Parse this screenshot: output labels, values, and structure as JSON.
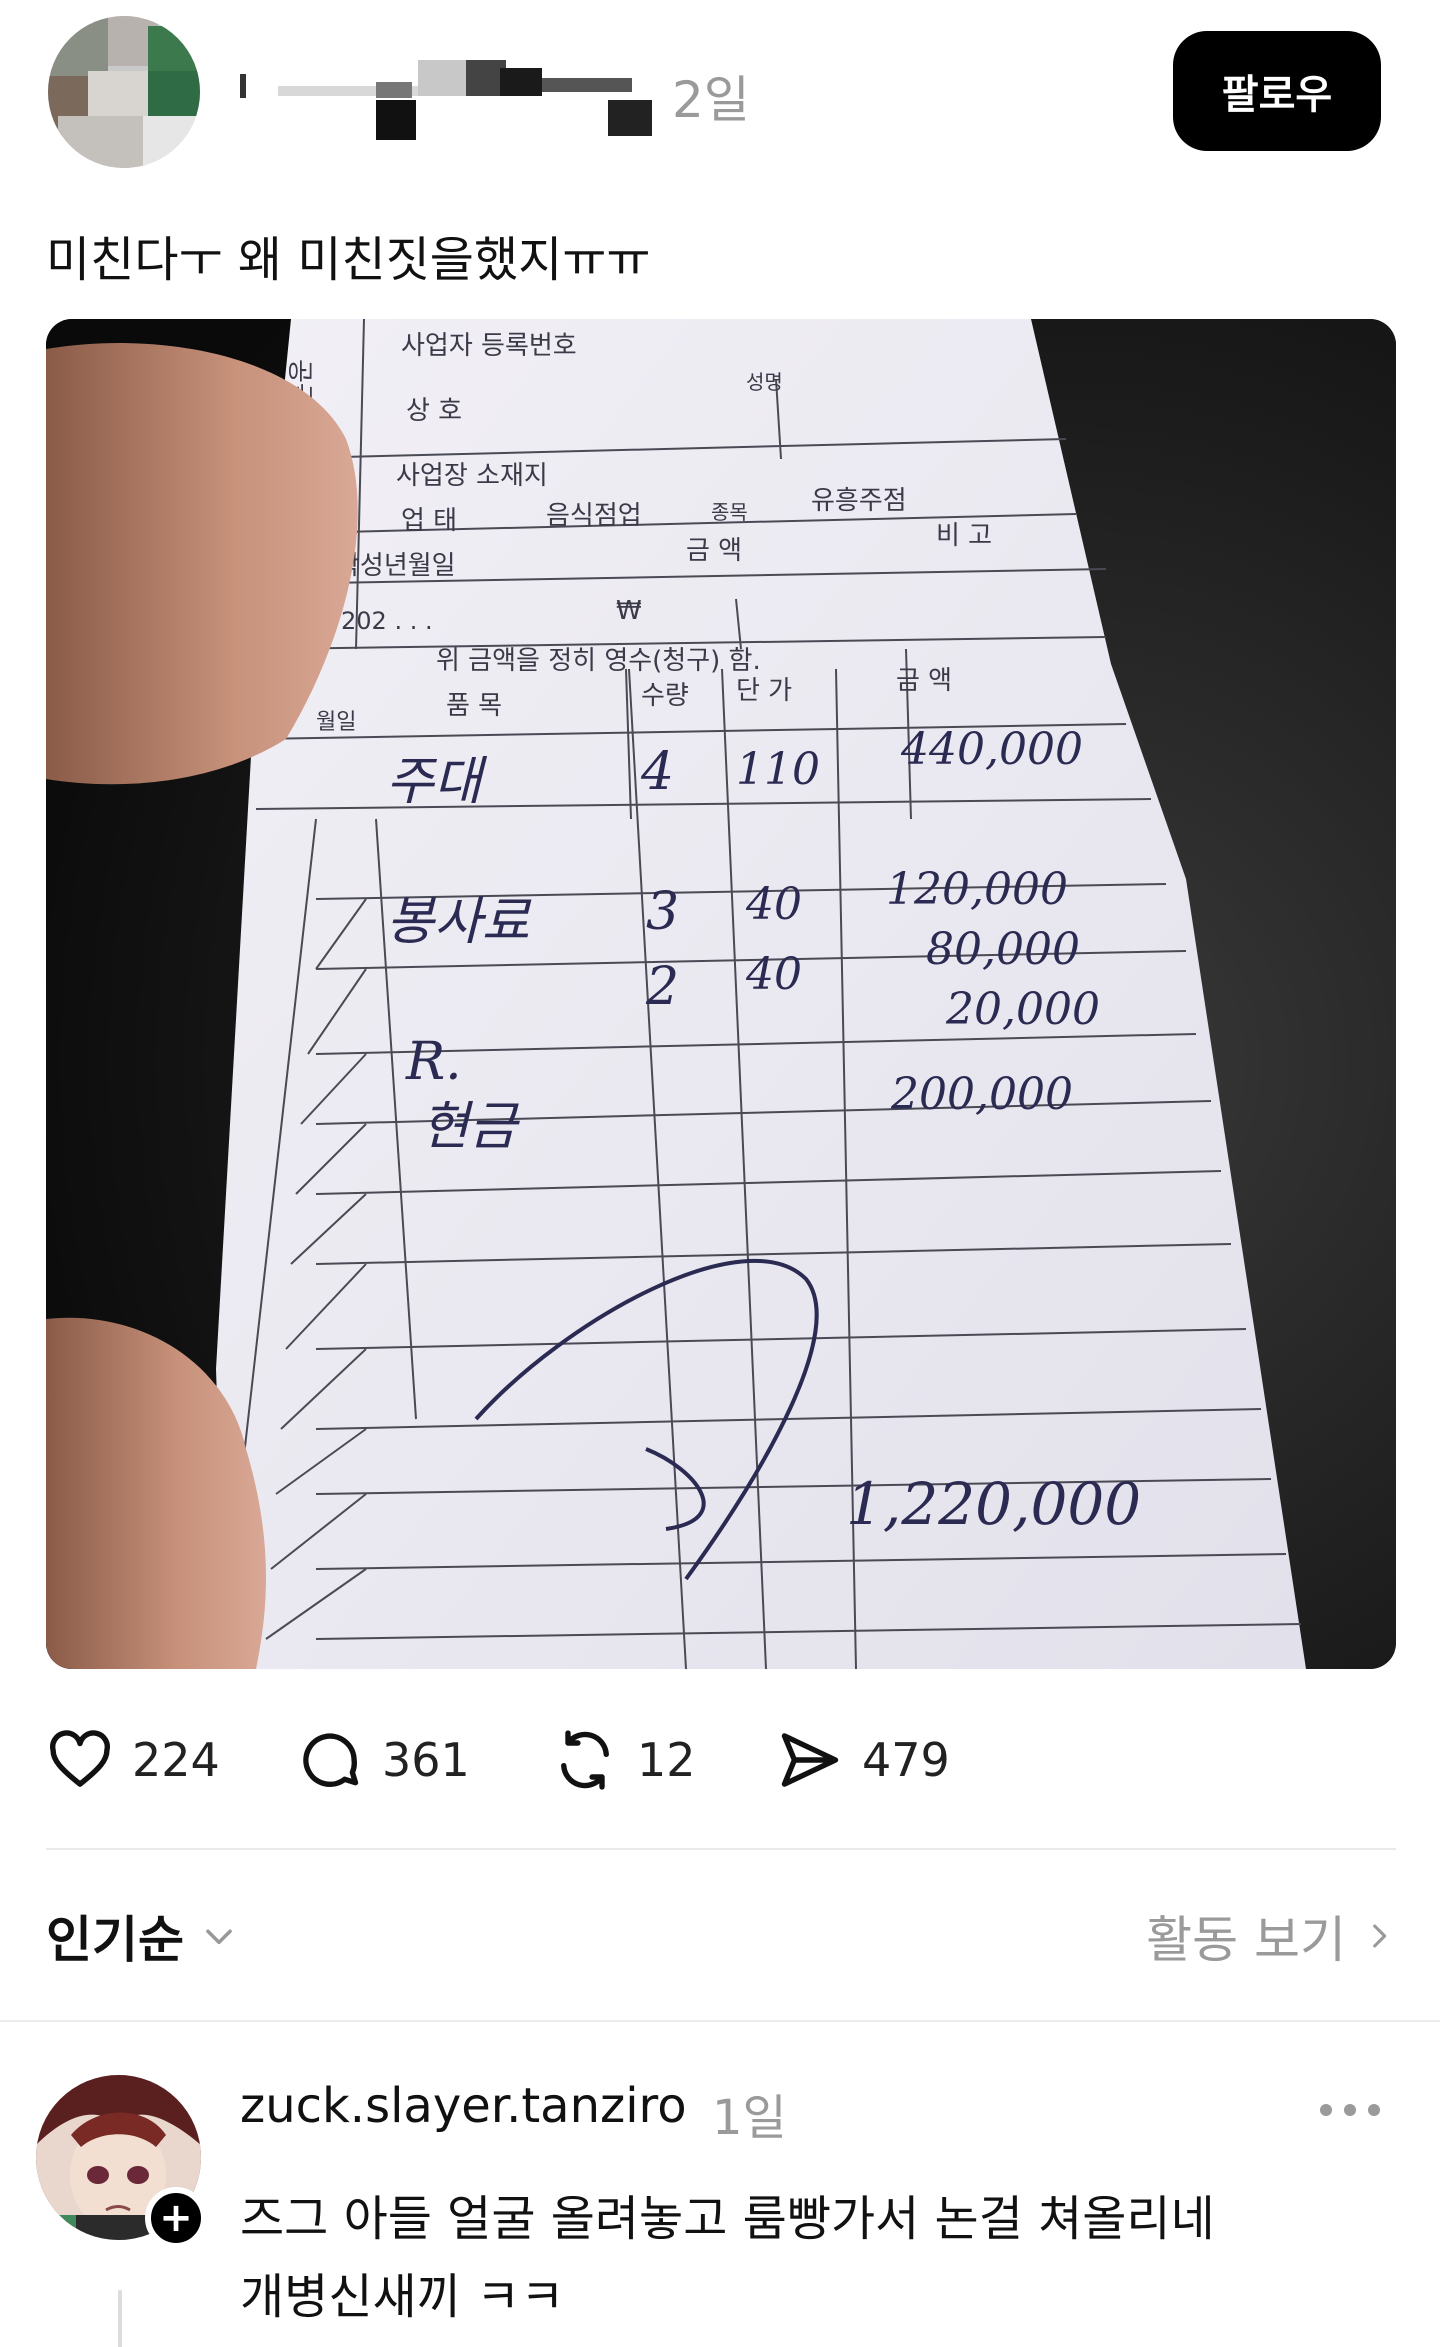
{
  "post": {
    "time": "2일",
    "follow_label": "팔로우",
    "text": "미친다ㅜ 왜 미친짓을했지ㅠㅠ"
  },
  "receipt": {
    "header_rows": [
      "사업자 등록번호",
      "상 호",
      "사업장 소재지"
    ],
    "side_label": "공급자",
    "name_label": "성명",
    "type_label": "업 태",
    "type_value": "음식점업",
    "kind_label": "종목",
    "kind_value": "유흥주점",
    "date_label": "작성년월일",
    "date_value": "202 . . .",
    "amount_label": "금 액",
    "amount_value": "₩",
    "note_label": "비 고",
    "statement": "위 금액을 정히 영수(청구) 함.",
    "col_headers": [
      "월일",
      "품 목",
      "수량",
      "단 가",
      "금 액"
    ],
    "handwritten": [
      "주대",
      "4",
      "110",
      "440,000",
      "봉사료",
      "3",
      "40",
      "120,000",
      "2",
      "40",
      "80,000",
      "20,000",
      "R.",
      "현금",
      "200,000",
      "1,220,000"
    ]
  },
  "actions": {
    "likes": "224",
    "comments": "361",
    "reposts": "12",
    "shares": "479"
  },
  "sort": {
    "label": "인기순",
    "activity": "활동 보기"
  },
  "comment": {
    "username": "zuck.slayer.tanziro",
    "time": "1일",
    "line1": "즈그 아들 얼굴 올려놓고 룸빵가서 논걸 쳐올리네",
    "line2": "개병신새끼 ㅋㅋ"
  }
}
